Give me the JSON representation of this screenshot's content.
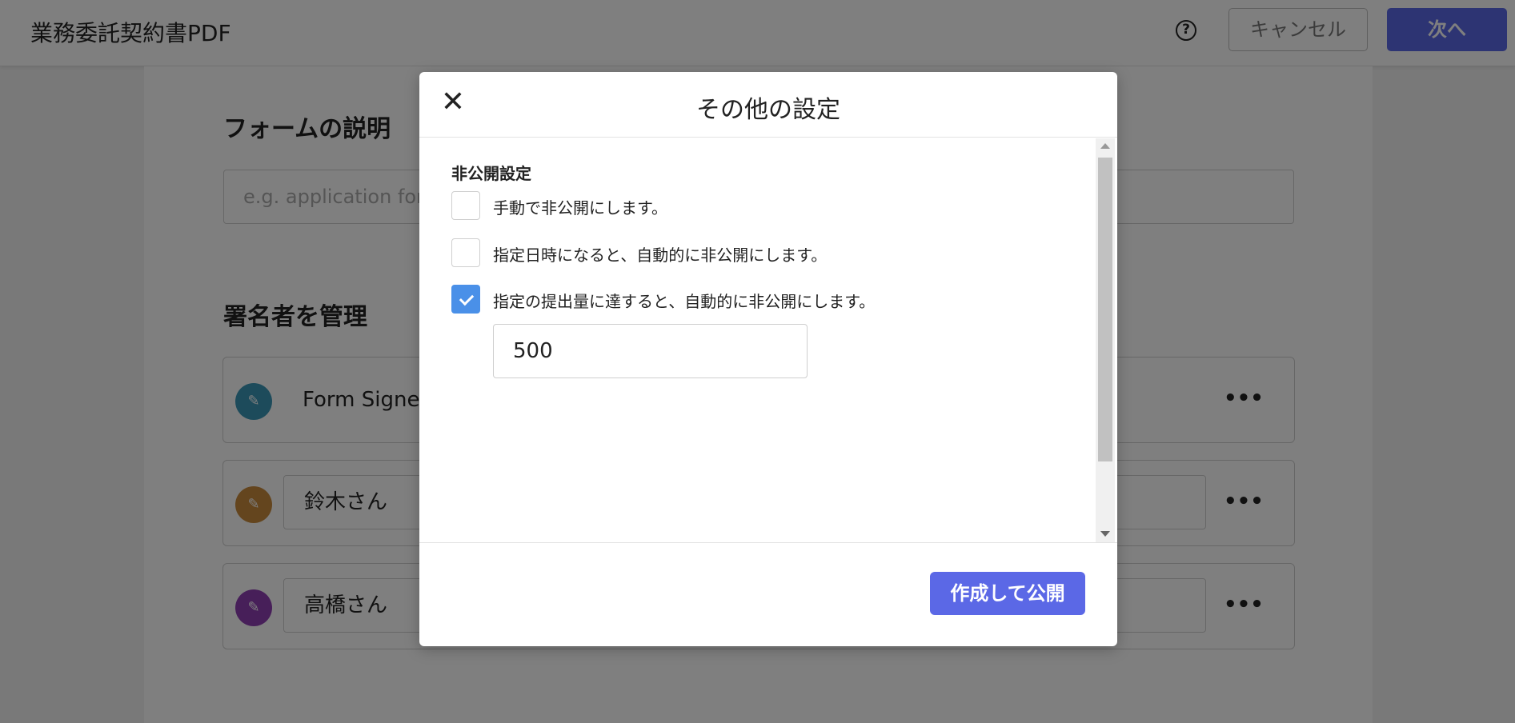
{
  "header": {
    "title": "業務委託契約書PDF",
    "help_icon": "help-circle-icon",
    "cancel_label": "キャンセル",
    "next_label": "次へ"
  },
  "form_description": {
    "title": "フォームの説明",
    "placeholder": "e.g. application form"
  },
  "signers": {
    "title": "署名者を管理",
    "items": [
      {
        "name": "Form Signer",
        "color": "#3a97b7",
        "icon": "pen-icon"
      },
      {
        "name": "鈴木さん",
        "color": "#c88a3d",
        "icon": "pen-icon"
      },
      {
        "name": "高橋さん",
        "color": "#8e3fb3",
        "icon": "pen-icon"
      }
    ],
    "more_icon": "more-horizontal-icon"
  },
  "modal": {
    "title": "その他の設定",
    "close_icon": "close-icon",
    "group_label": "非公開設定",
    "options": [
      {
        "label": "手動で非公開にします。",
        "checked": false
      },
      {
        "label": "指定日時になると、自動的に非公開にします。",
        "checked": false
      },
      {
        "label": "指定の提出量に達すると、自動的に非公開にします。",
        "checked": true
      }
    ],
    "submission_limit": "500",
    "publish_label": "作成して公開"
  },
  "colors": {
    "primary": "#5b68e6",
    "checkbox_checked": "#4a90e8"
  }
}
